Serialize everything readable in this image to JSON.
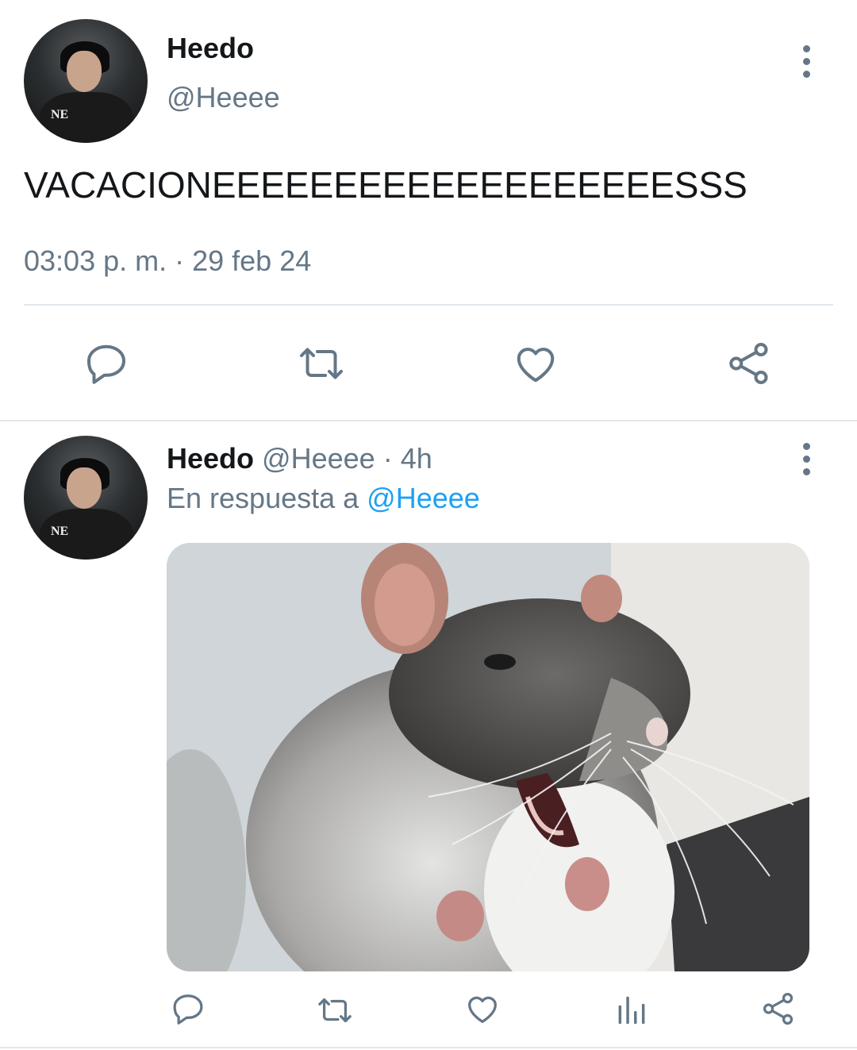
{
  "main_tweet": {
    "author_name": "Heedo",
    "author_handle": "@Heeee",
    "text": "VACACIONEEEEEEEEEEEEEEEEEEESSS",
    "timestamp": "03:03 p. m. · 29 feb 24",
    "actions": [
      "reply-icon",
      "retweet-icon",
      "like-icon",
      "share-icon"
    ]
  },
  "reply_tweet": {
    "author_name": "Heedo",
    "author_handle": "@Heeee",
    "separator": "·",
    "time_ago": "4h",
    "reply_prefix": "En respuesta a",
    "reply_to": "@Heeee",
    "media": "rat-photo",
    "actions": [
      "reply-icon",
      "retweet-icon",
      "like-icon",
      "analytics-icon",
      "share-icon"
    ]
  },
  "colors": {
    "text": "#14171a",
    "muted": "#657786",
    "link": "#1da1f2",
    "divider": "#e1e8ed"
  }
}
